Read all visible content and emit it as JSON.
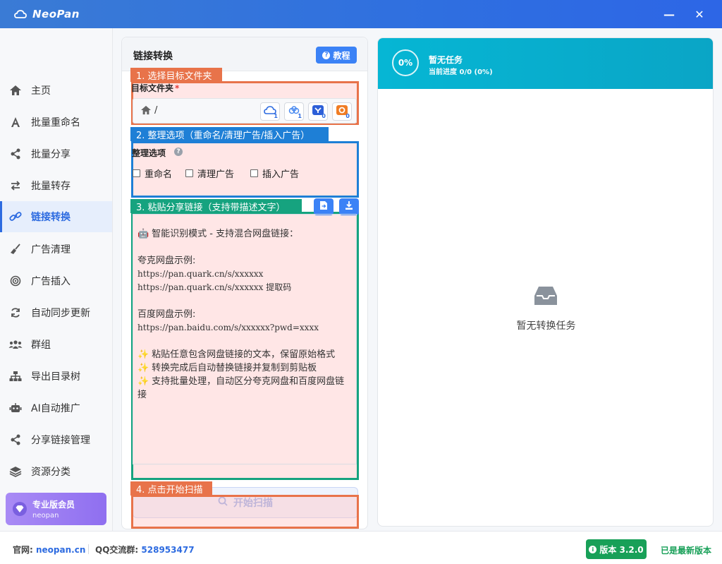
{
  "app": {
    "title": "NeoPan"
  },
  "window": {
    "minimize": "—",
    "close": "✕"
  },
  "sidebar": {
    "items": [
      {
        "label": "主页",
        "icon": "home-icon"
      },
      {
        "label": "批量重命名",
        "icon": "font-icon"
      },
      {
        "label": "批量分享",
        "icon": "share-icon"
      },
      {
        "label": "批量转存",
        "icon": "transfer-icon"
      },
      {
        "label": "链接转换",
        "icon": "link-icon"
      },
      {
        "label": "广告清理",
        "icon": "broom-icon"
      },
      {
        "label": "广告插入",
        "icon": "target-icon"
      },
      {
        "label": "自动同步更新",
        "icon": "sync-icon"
      },
      {
        "label": "群组",
        "icon": "group-icon"
      },
      {
        "label": "导出目录树",
        "icon": "tree-icon"
      },
      {
        "label": "AI自动推广",
        "icon": "robot-icon"
      },
      {
        "label": "分享链接管理",
        "icon": "share-icon"
      },
      {
        "label": "资源分类",
        "icon": "layers-icon"
      }
    ],
    "member": {
      "title": "专业版会员",
      "subtitle": "neopan"
    }
  },
  "panel": {
    "title": "链接转换",
    "tutorial_label": "教程",
    "steps": {
      "s1": "1. 选择目标文件夹",
      "s2": "2. 整理选项（重命名/清理广告/插入广告）",
      "s3": "3. 粘贴分享链接（支持带描述文字）",
      "s4": "4. 点击开始扫描"
    },
    "folder": {
      "label": "目标文件夹",
      "required": "*",
      "path": "/",
      "disks": [
        {
          "name": "quark-cloud-icon",
          "count": "1"
        },
        {
          "name": "baidu-cloud-icon",
          "count": "1"
        },
        {
          "name": "tianyi-cloud-icon",
          "count": "0"
        },
        {
          "name": "uc-cloud-icon",
          "count": "0"
        }
      ]
    },
    "options": {
      "label": "整理选项",
      "help": "?",
      "rename": "重命名",
      "clean_ads": "清理广告",
      "insert_ads": "插入广告"
    },
    "textarea": {
      "intro": "智能识别模式 - 支持混合网盘链接：",
      "quark_title": "夸克网盘示例:",
      "quark_link1": "https://pan.quark.cn/s/xxxxxx",
      "quark_link2": "https://pan.quark.cn/s/xxxxxx 提取码",
      "baidu_title": "百度网盘示例:",
      "baidu_link": "https://pan.baidu.com/s/xxxxxx?pwd=xxxx",
      "tip1": "粘贴任意包含网盘链接的文本，保留原始格式",
      "tip2": "转换完成后自动替换链接并复制到剪贴板",
      "tip3": "支持批量处理，自动区分夸克网盘和百度网盘链接"
    },
    "scan_label": "开始扫描"
  },
  "tasks": {
    "progress_percent": "0%",
    "title": "暂无任务",
    "progress_text": "当前进度 0/0 (0%)",
    "empty_text": "暂无转换任务"
  },
  "footer": {
    "site_label": "官网:",
    "site": "neopan.cn",
    "qq_label": "QQ交流群:",
    "qq": "528953477",
    "version": "版本 3.2.0",
    "latest": "已是最新版本"
  },
  "colors": {
    "brand": "#2d6be0",
    "step1": "#e8734a",
    "step2": "#1e7fd6",
    "step3": "#16a37f",
    "step4": "#e8734a",
    "task_header": "#06b6d4",
    "success": "#18a058"
  }
}
